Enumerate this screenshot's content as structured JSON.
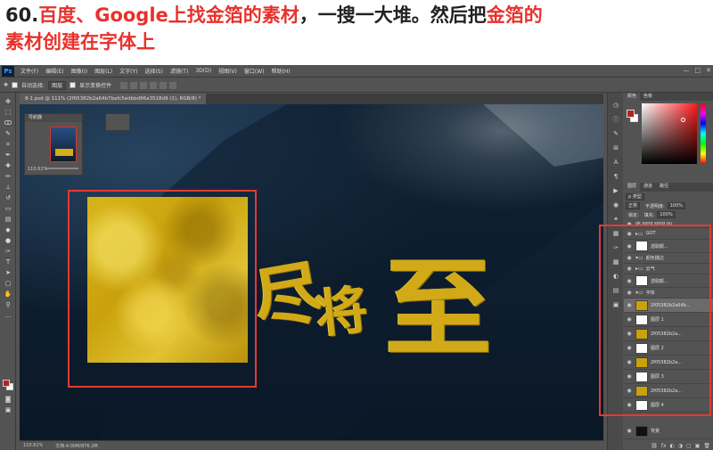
{
  "caption": {
    "number": "60.",
    "line1_red1": "百度、Google上找金箔的素材",
    "line1_dark": "，一搜一大堆。然后把",
    "line1_red2": "金箔的",
    "line2_red": "素材创建在字体上"
  },
  "app": {
    "logo": "Ps",
    "menus": [
      "文件(F)",
      "编辑(E)",
      "图像(I)",
      "图层(L)",
      "文字(Y)",
      "选择(S)",
      "滤镜(T)",
      "3D(D)",
      "视图(V)",
      "窗口(W)",
      "帮助(H)"
    ],
    "window_controls": [
      "—",
      "□",
      "✕"
    ]
  },
  "options": {
    "auto_select_label": "自动选择:",
    "auto_select_target": "图层",
    "show_transform": "显示变换控件"
  },
  "document": {
    "tab_title": "8-1.psd @ 111% (2f05382b2a64b7bafc5edbbd96a3518d9 (1), RGB/8) *"
  },
  "canvas": {
    "glyph_1": "尽",
    "glyph_2": "将",
    "glyph_3": "至"
  },
  "navigator": {
    "title": "导航器",
    "zoom": "110.61%"
  },
  "status": {
    "zoom": "110.61%",
    "doc": "文档:4.00M/876.2M"
  },
  "color_panel": {
    "tabs": [
      "颜色",
      "色板"
    ],
    "fg_color": "#b3241e",
    "bg_color": "#ffffff"
  },
  "layers_panel": {
    "tabs": [
      "图层",
      "通道",
      "路径"
    ],
    "filter_kind": "ρ 类型",
    "blend_mode": "正常",
    "opacity_label": "不透明度:",
    "opacity_value": "100%",
    "lock_label": "锁定:",
    "fill_label": "填充:",
    "fill_value": "100%",
    "layers": [
      {
        "name": "ok song song ou",
        "type": "text",
        "selected": false
      },
      {
        "name": "GOT",
        "type": "group",
        "selected": false
      },
      {
        "name": "选取颜...",
        "type": "adjust",
        "selected": false
      },
      {
        "name": "颜色描边",
        "type": "group",
        "selected": false
      },
      {
        "name": "云气",
        "type": "group",
        "selected": false
      },
      {
        "name": "选取颜...",
        "type": "adjust",
        "selected": false
      },
      {
        "name": "字体",
        "type": "group",
        "selected": false
      },
      {
        "name": "2f05382b2a64b...",
        "type": "gold",
        "selected": true
      },
      {
        "name": "图层 1",
        "type": "layer",
        "selected": false
      },
      {
        "name": "2f05382b2a...",
        "type": "gold",
        "selected": false
      },
      {
        "name": "图层 2",
        "type": "layer",
        "selected": false
      },
      {
        "name": "2f05382b2a...",
        "type": "gold",
        "selected": false
      },
      {
        "name": "图层 3",
        "type": "layer",
        "selected": false
      },
      {
        "name": "2f05382b2a...",
        "type": "gold",
        "selected": false
      },
      {
        "name": "图层 4",
        "type": "layer",
        "selected": false
      },
      {
        "name": "背景",
        "type": "background",
        "selected": false
      }
    ],
    "footer_icons": [
      "⛓",
      "fx",
      "◐",
      "◑",
      "▢",
      "▣",
      "🗑"
    ]
  }
}
